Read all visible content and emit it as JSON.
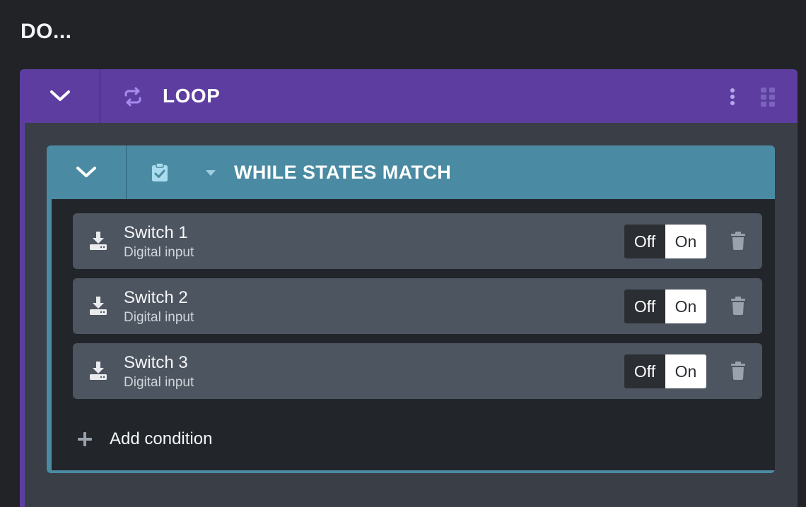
{
  "page": {
    "title": "DO..."
  },
  "loop": {
    "title": "LOOP",
    "icons": {
      "toggle": "chevron-down-icon",
      "type": "repeat-icon",
      "more": "more-vertical-icon",
      "drag": "drag-handle-icon"
    },
    "color": "#5d3ea0"
  },
  "while": {
    "title": "WHILE STATES MATCH",
    "icons": {
      "toggle": "chevron-down-icon",
      "type": "clipboard-check-icon",
      "caret": "caret-down-icon"
    },
    "color": "#4a8ba3"
  },
  "conditions": [
    {
      "name": "Switch 1",
      "type": "Digital input",
      "off_label": "Off",
      "on_label": "On",
      "selected": "On"
    },
    {
      "name": "Switch 2",
      "type": "Digital input",
      "off_label": "Off",
      "on_label": "On",
      "selected": "On"
    },
    {
      "name": "Switch 3",
      "type": "Digital input",
      "off_label": "Off",
      "on_label": "On",
      "selected": "On"
    }
  ],
  "add_condition": {
    "label": "Add condition"
  }
}
